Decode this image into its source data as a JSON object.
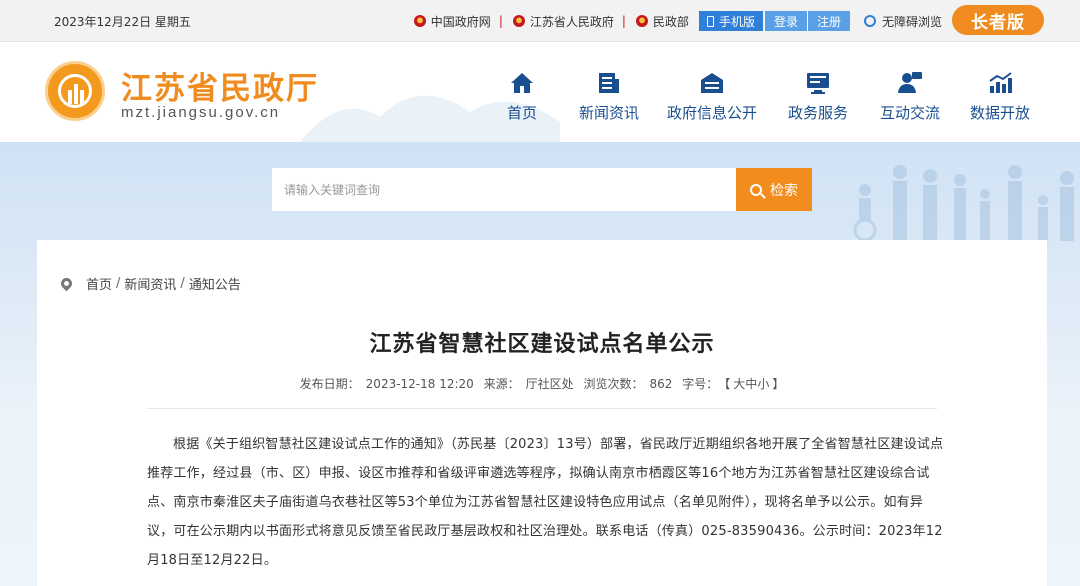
{
  "topbar": {
    "date": "2023年12月22日 星期五",
    "links": [
      "中国政府网",
      "江苏省人民政府",
      "民政部"
    ],
    "mobile_label": "手机版",
    "login_label": "登录",
    "register_label": "注册",
    "accessibility_label": "无障碍浏览",
    "elder_label": "长者版"
  },
  "header": {
    "site_name": "江苏省民政厅",
    "site_url": "mzt.jiangsu.gov.cn",
    "nav": [
      {
        "label": "首页",
        "icon": "home-icon"
      },
      {
        "label": "新闻资讯",
        "icon": "news-icon"
      },
      {
        "label": "政府信息公开",
        "icon": "info-icon"
      },
      {
        "label": "政务服务",
        "icon": "service-icon"
      },
      {
        "label": "互动交流",
        "icon": "interaction-icon"
      },
      {
        "label": "数据开放",
        "icon": "data-chart-icon"
      }
    ]
  },
  "search": {
    "placeholder": "请输入关键词查询",
    "button_label": "检索"
  },
  "breadcrumb": {
    "items": [
      "首页",
      "新闻资讯",
      "通知公告"
    ],
    "separator": "/"
  },
  "article": {
    "title": "江苏省智慧社区建设试点名单公示",
    "publish_label": "发布日期：",
    "publish_date": "2023-12-18 12:20",
    "source_label": "来源：",
    "source": "厅社区处",
    "views_label": "浏览次数：",
    "views": "862",
    "fontsize_label": "字号：",
    "fontsize_open": "【",
    "fontsize_large": "大",
    "fontsize_medium": "中",
    "fontsize_small": "小",
    "fontsize_close": "】",
    "body": "根据《关于组织智慧社区建设试点工作的通知》（苏民基〔2023〕13号）部署，省民政厅近期组织各地开展了全省智慧社区建设试点推荐工作，经过县（市、区）申报、设区市推荐和省级评审遴选等程序，拟确认南京市栖霞区等16个地方为江苏省智慧社区建设综合试点、南京市秦淮区夫子庙街道乌衣巷社区等53个单位为江苏省智慧社区建设特色应用试点（名单见附件），现将名单予以公示。如有异议，可在公示期内以书面形式将意见反馈至省民政厅基层政权和社区治理处。联系电话（传真）025-83590436。公示时间：2023年12月18日至12月22日。"
  },
  "colors": {
    "accent_orange": "#f28c1c",
    "nav_blue": "#1a4f8f",
    "mobile_blue": "#2f7fd8"
  }
}
